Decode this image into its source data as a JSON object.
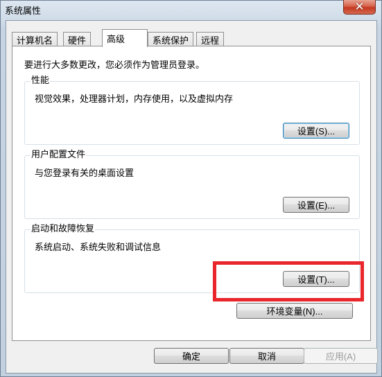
{
  "window": {
    "title": "系统属性",
    "close_label": "✕"
  },
  "tabs": [
    {
      "label": "计算机名",
      "active": false
    },
    {
      "label": "硬件",
      "active": false
    },
    {
      "label": "高级",
      "active": true
    },
    {
      "label": "系统保护",
      "active": false
    },
    {
      "label": "远程",
      "active": false
    }
  ],
  "advanced": {
    "admin_note": "要进行大多数更改，您必须作为管理员登录。",
    "performance": {
      "title": "性能",
      "description": "视觉效果，处理器计划，内存使用，以及虚拟内存",
      "button": "设置(S)..."
    },
    "user_profiles": {
      "title": "用户配置文件",
      "description": "与您登录有关的桌面设置",
      "button": "设置(E)..."
    },
    "startup_recovery": {
      "title": "启动和故障恢复",
      "description": "系统启动、系统失败和调试信息",
      "button": "设置(T)..."
    },
    "env_button": "环境变量(N)...",
    "highlight_color": "#e8262b"
  },
  "footer": {
    "ok": "确定",
    "cancel": "取消",
    "apply": "应用(A)"
  }
}
